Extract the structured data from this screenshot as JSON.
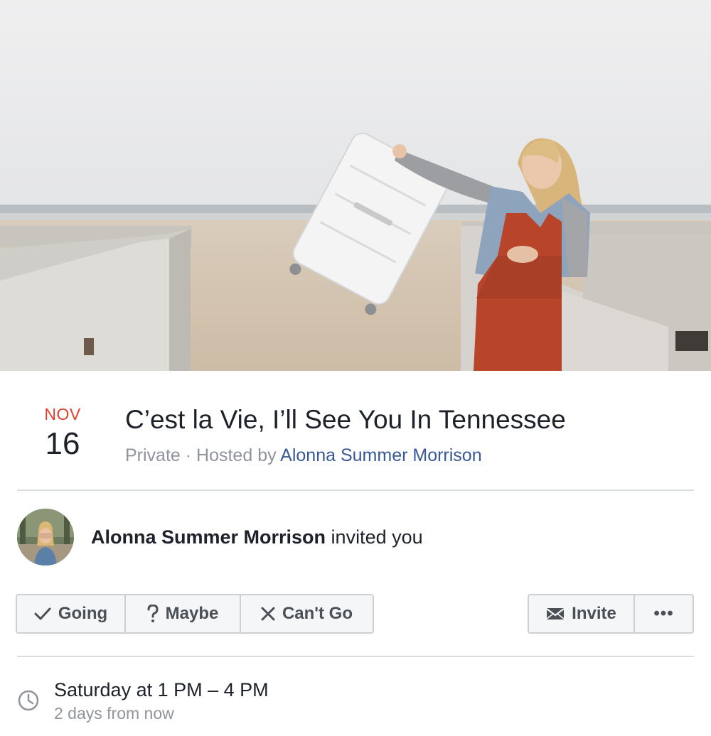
{
  "event": {
    "month": "NOV",
    "day": "16",
    "title": "C’est la Vie, I’ll See You In Tennessee",
    "privacy": "Private",
    "separator": " · ",
    "hosted_by_prefix": "Hosted by ",
    "host": "Alonna Summer Morrison"
  },
  "invite": {
    "inviter": "Alonna Summer Morrison",
    "action": " invited you"
  },
  "rsvp": {
    "going_label": "Going",
    "maybe_label": "Maybe",
    "cant_go_label": "Can't Go"
  },
  "actions": {
    "invite_label": "Invite",
    "more_label": "•••"
  },
  "time": {
    "main": "Saturday at 1 PM – 4 PM",
    "relative": "2 days from now"
  },
  "icons": {
    "going": "check-icon",
    "maybe": "question-icon",
    "cant_go": "x-icon",
    "invite": "envelope-icon",
    "time": "clock-icon"
  },
  "colors": {
    "month": "#e2402f",
    "link": "#385898",
    "secondary_text": "#90949c",
    "primary_text": "#1d2129",
    "button_bg": "#f5f6f7",
    "button_border": "#ccd0d5"
  }
}
